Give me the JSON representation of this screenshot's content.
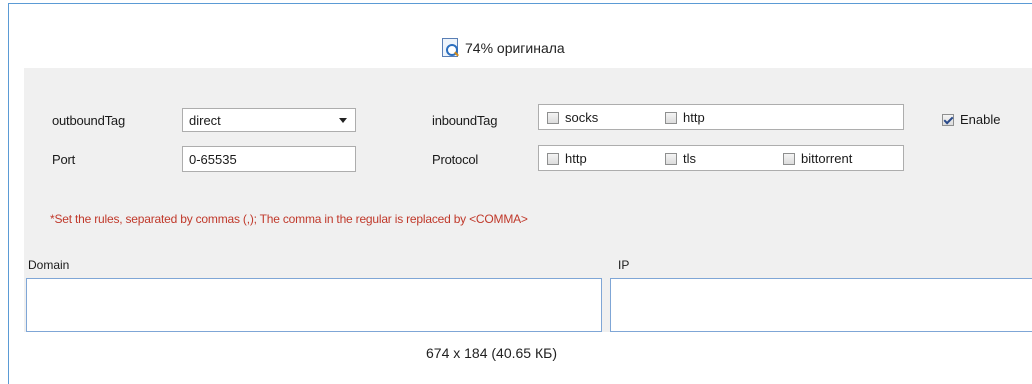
{
  "viewer": {
    "zoom_caption": "74% оригинала",
    "size_caption": "674 x 184 (40.65 КБ)"
  },
  "form": {
    "outbound_tag": {
      "label": "outboundTag",
      "value": "direct"
    },
    "port": {
      "label": "Port",
      "value": "0-65535"
    },
    "inbound_tag": {
      "label": "inboundTag",
      "options": [
        {
          "label": "socks",
          "checked": false
        },
        {
          "label": "http",
          "checked": false
        }
      ]
    },
    "protocol": {
      "label": "Protocol",
      "options": [
        {
          "label": "http",
          "checked": false
        },
        {
          "label": "tls",
          "checked": false
        },
        {
          "label": "bittorrent",
          "checked": false
        }
      ]
    },
    "enable": {
      "label": "Enable",
      "checked": true
    },
    "note": "*Set the rules, separated by commas (,); The comma in the regular is replaced by <COMMA>",
    "domain_label": "Domain",
    "ip_label": "IP"
  },
  "colors": {
    "note": "#c0392b",
    "frame": "#5b9bd5",
    "panel": "#f0f0f0"
  }
}
